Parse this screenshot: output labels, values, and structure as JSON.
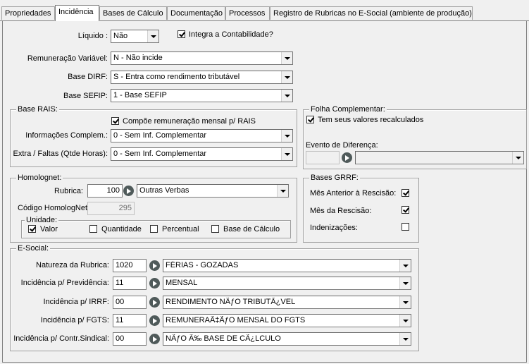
{
  "tabs": [
    "Propriedades",
    "Incidência",
    "Bases de Cálculo",
    "Documentação",
    "Processos",
    "Registro de Rubricas no E-Social (ambiente de produção)"
  ],
  "liquido": {
    "label": "Líquido :",
    "value": "Não"
  },
  "integra": {
    "label": "Integra a Contabilidade?",
    "checked": true
  },
  "remuneracao": {
    "label": "Remuneração Variável:",
    "value": "N - Não incide"
  },
  "base_dirf": {
    "label": "Base DIRF:",
    "value": "S - Entra como rendimento tributável"
  },
  "base_sefip": {
    "label": "Base SEFIP:",
    "value": "1 - Base SEFIP"
  },
  "rais": {
    "title": "Base RAIS:",
    "compoe_label": "Compõe remuneração mensal p/ RAIS",
    "compoe_checked": true,
    "info_label": "Informações Complem.:",
    "info_value": "0 - Sem Inf. Complementar",
    "extra_label": "Extra / Faltas (Qtde Horas):",
    "extra_value": "0 - Sem Inf. Complementar"
  },
  "folha": {
    "title": "Folha Complementar:",
    "recalc_label": "Tem seus valores recalculados",
    "recalc_checked": true,
    "evento_label": "Evento de Diferença:",
    "evento_code": "",
    "evento_desc": ""
  },
  "homolognet": {
    "title": "Homolognet:",
    "rubrica_label": "Rubrica:",
    "rubrica_code": "100",
    "rubrica_desc": "Outras Verbas",
    "codigo_label": "Código HomologNet",
    "codigo_value": "295",
    "unidade_title": "Unidade:",
    "unidades": [
      {
        "label": "Valor",
        "checked": true
      },
      {
        "label": "Quantidade",
        "checked": false
      },
      {
        "label": "Percentual",
        "checked": false
      },
      {
        "label": "Base de Cálculo",
        "checked": false
      }
    ]
  },
  "grrf": {
    "title": "Bases GRRF:",
    "items": [
      {
        "label": "Mês Anterior à Rescisão:",
        "checked": true
      },
      {
        "label": "Mês da Rescisão:",
        "checked": true
      },
      {
        "label": "Indenizações:",
        "checked": false
      }
    ]
  },
  "esocial": {
    "title": "E-Social:",
    "rows": [
      {
        "label": "Natureza da Rubrica:",
        "code": "1020",
        "desc": "FÉRIAS - GOZADAS"
      },
      {
        "label": "Incidência p/ Previdência:",
        "code": "11",
        "desc": "MENSAL"
      },
      {
        "label": "Incidência p/ IRRF:",
        "code": "00",
        "desc": "RENDIMENTO NÃƒO TRIBUTÃ¿VEL"
      },
      {
        "label": "Incidência p/ FGTS:",
        "code": "11",
        "desc": "REMUNERAÃ‡ÃƒO MENSAL DO FGTS"
      },
      {
        "label": "Incidência p/ Contr.Sindical:",
        "code": "00",
        "desc": "NÃƒO Ã‰ BASE DE CÃ¿LCULO"
      }
    ]
  }
}
